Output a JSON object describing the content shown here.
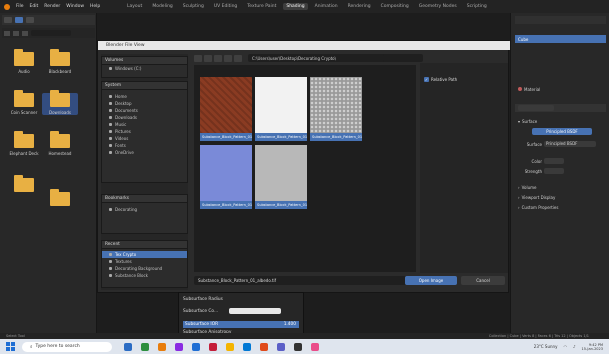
{
  "menu": {
    "items": [
      "File",
      "Edit",
      "Render",
      "Window",
      "Help"
    ]
  },
  "workspace_tabs": [
    {
      "label": "Layout",
      "active": false
    },
    {
      "label": "Modeling",
      "active": false
    },
    {
      "label": "Sculpting",
      "active": false
    },
    {
      "label": "UV Editing",
      "active": false
    },
    {
      "label": "Texture Paint",
      "active": false
    },
    {
      "label": "Shading",
      "active": true
    },
    {
      "label": "Animation",
      "active": false
    },
    {
      "label": "Rendering",
      "active": false
    },
    {
      "label": "Compositing",
      "active": false
    },
    {
      "label": "Geometry Nodes",
      "active": false
    },
    {
      "label": "Scripting",
      "active": false
    }
  ],
  "left_browser": {
    "folders": [
      {
        "label": "Audio"
      },
      {
        "label": "Blackbeard"
      },
      {
        "label": "Coin Scanner"
      },
      {
        "label": "Downloads"
      },
      {
        "label": "Elephant Deck"
      },
      {
        "label": "Homestead"
      }
    ]
  },
  "dialog": {
    "title": "Blender File View",
    "path": "C:\\Users\\user\\Desktop\\Decorating Crypto\\",
    "filename": "Substance_Block_Pattern_01_albedo.tif",
    "primary_button": "Open Image",
    "cancel_button": "Cancel",
    "option_relative": "Relative Path",
    "volumes_header": "Volumes",
    "volumes": [
      {
        "label": "Windows (C:)"
      }
    ],
    "system_header": "System",
    "system_items": [
      {
        "label": "Home"
      },
      {
        "label": "Desktop"
      },
      {
        "label": "Documents"
      },
      {
        "label": "Downloads"
      },
      {
        "label": "Music"
      },
      {
        "label": "Pictures"
      },
      {
        "label": "Videos"
      },
      {
        "label": "Fonts"
      },
      {
        "label": "OneDrive"
      }
    ],
    "bookmarks_header": "Bookmarks",
    "bookmarks": [
      {
        "label": "Decorating"
      }
    ],
    "recent_header": "Recent",
    "recent": [
      {
        "label": "Tex Crypto",
        "selected": true
      },
      {
        "label": "Textures",
        "selected": false
      },
      {
        "label": "Decorating Background",
        "selected": false
      },
      {
        "label": "Substance Block",
        "selected": false
      }
    ],
    "thumbnails": [
      {
        "caption": "Substance_Block_Pattern_01_albedo.tif",
        "color": "#8a3b22"
      },
      {
        "caption": "Substance_Block_Pattern_01_ao.tif",
        "color": "#f2f2f2"
      },
      {
        "caption": "Substance_Block_Pattern_01_height.tif",
        "color": "#9a9a9a"
      },
      {
        "caption": "Substance_Block_Pattern_01_normal.tif",
        "color": "#7a8ad8"
      },
      {
        "caption": "Substance_Block_Pattern_01_rough.tif",
        "color": "#b8b8b8"
      }
    ]
  },
  "properties": {
    "object_label": "Cube",
    "material_label": "Material",
    "surface_header": "Surface",
    "surface_value": "Principled BSDF",
    "base_label": "Surface",
    "base_value": "Principled BSDF",
    "rows": [
      "Color",
      "Strength"
    ],
    "sections": [
      "Volume",
      "Viewport Display",
      "Custom Properties"
    ]
  },
  "popup": {
    "title": "Subsurface Radius",
    "rows": [
      {
        "label": "Subsurface Co..."
      },
      {
        "label": "Subsurface IOR",
        "value": "1.400"
      },
      {
        "label": "Subsurface Anisotropy"
      }
    ]
  },
  "status": {
    "left": "Select Tool",
    "right": "Collection | Cube | Verts 8 | Faces 6 | Tris 12 | Objects 1/1"
  },
  "taskbar": {
    "search_placeholder": "Type here to search",
    "weather": "23°C Sunny",
    "time": "9:42 PM",
    "date": "15-Jan-2023",
    "app_colors": [
      "#2b6cc4",
      "#2d8f3e",
      "#e87d0d",
      "#8a2be2",
      "#1f6ed4",
      "#c41e3a",
      "#f4b400",
      "#0078d4",
      "#e04a1a",
      "#5b5fc7",
      "#333333",
      "#ea4c89"
    ]
  },
  "colors": {
    "accent": "#4772b3",
    "folder": "#e8b043",
    "orange": "#e87d0d"
  }
}
